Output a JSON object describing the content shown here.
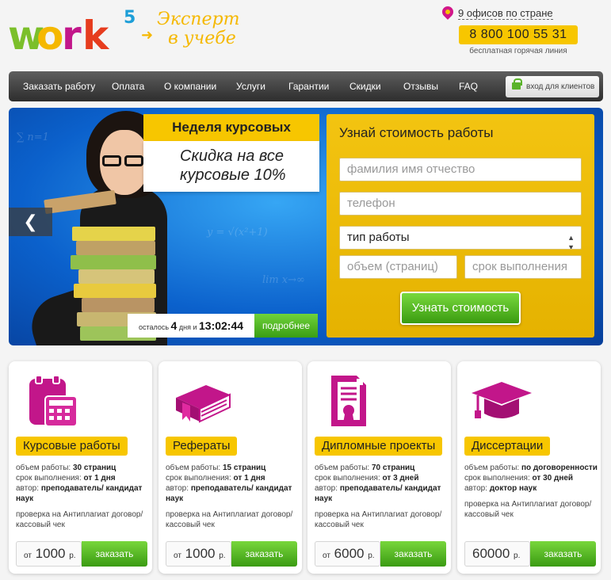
{
  "logo": {
    "w": "w",
    "o": "o",
    "r": "r",
    "k": "k",
    "sup": "5"
  },
  "slogan": {
    "line1": "Эксперт",
    "line2": "в учебе"
  },
  "header": {
    "offices": "9 офисов по стране",
    "phone": "8 800 100 55 31",
    "hotline": "бесплатная горячая линия"
  },
  "nav": {
    "items": [
      "Заказать работу",
      "Оплата",
      "О компании",
      "Услуги",
      "Гарантии",
      "Скидки",
      "Отзывы",
      "FAQ"
    ],
    "login": "вход для клиентов"
  },
  "hero": {
    "promo_title": "Неделя курсовых",
    "promo_text": "Скидка на все курсовые 10%",
    "timer_prefix": "осталось",
    "timer_days": "4",
    "timer_mid": "дня и",
    "timer_time": "13:02:44",
    "more": "подробнее"
  },
  "form": {
    "title": "Узнай стоимость работы",
    "fio_placeholder": "фамилия имя отчество",
    "phone_placeholder": "телефон",
    "type_select": "тип работы",
    "volume_placeholder": "объем (страниц)",
    "deadline_placeholder": "срок выполнения",
    "submit": "Узнать стоимость"
  },
  "cards": [
    {
      "name": "Курсовые работы",
      "volume_label": "объем работы:",
      "volume": "30 страниц",
      "term_label": "срок выполнения:",
      "term": "от 1 дня",
      "author_label": "автор:",
      "author": "преподаватель/ кандидат наук",
      "check": "проверка на Антиплагиат договор/ кассовый чек",
      "price_prefix": "от",
      "price": "1000",
      "currency": "р.",
      "order": "заказать"
    },
    {
      "name": "Рефераты",
      "volume_label": "объем работы:",
      "volume": "15 страниц",
      "term_label": "срок выполнения:",
      "term": "от 1 дня",
      "author_label": "автор:",
      "author": "преподаватель/ кандидат наук",
      "check": "проверка на Антиплагиат договор/ кассовый чек",
      "price_prefix": "от",
      "price": "1000",
      "currency": "р.",
      "order": "заказать"
    },
    {
      "name": "Дипломные проекты",
      "volume_label": "объем работы:",
      "volume": "70 страниц",
      "term_label": "срок выполнения:",
      "term": "от 3 дней",
      "author_label": "автор:",
      "author": "преподаватель/ кандидат наук",
      "check": "проверка на Антиплагиат договор/ кассовый чек",
      "price_prefix": "от",
      "price": "6000",
      "currency": "р.",
      "order": "заказать"
    },
    {
      "name": "Диссертации",
      "volume_label": "объем работы:",
      "volume": "по договоренности",
      "term_label": "срок выполнения:",
      "term": "от 30 дней",
      "author_label": "автор:",
      "author": "доктор наук",
      "check": "проверка на Антиплагиат договор/ кассовый чек",
      "price_prefix": "",
      "price": "60000",
      "currency": "р.",
      "order": "заказать"
    }
  ],
  "colors": {
    "yellow": "#f7c600",
    "green": "#4db020",
    "magenta": "#c2168a",
    "blue": "#0b61cc"
  },
  "icons": [
    "calculator-icon",
    "book-icon",
    "certificate-icon",
    "graduation-cap-icon",
    "map-pin-icon",
    "lock-icon",
    "chevron-left-icon"
  ]
}
